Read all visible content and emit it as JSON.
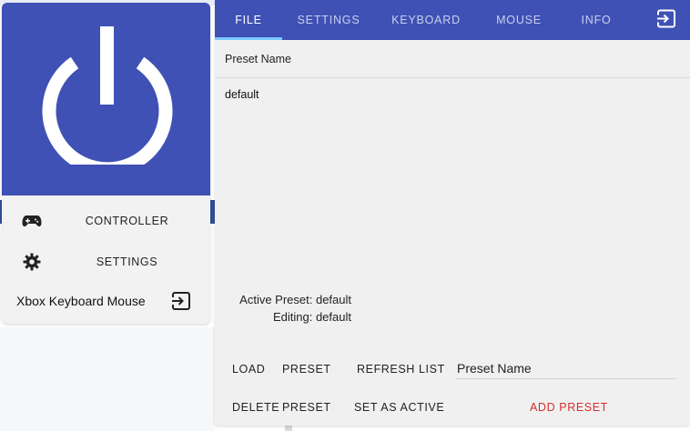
{
  "sidebar": {
    "items": [
      {
        "label": "CONTROLLER",
        "icon": "gamepad-icon"
      },
      {
        "label": "SETTINGS",
        "icon": "gear-icon"
      }
    ],
    "app_title": "Xbox Keyboard Mouse",
    "exit_icon": "exit-icon",
    "accent": "#3f51b5"
  },
  "tabs": [
    {
      "label": "FILE",
      "active": true
    },
    {
      "label": "SETTINGS",
      "active": false
    },
    {
      "label": "KEYBOARD",
      "active": false
    },
    {
      "label": "MOUSE",
      "active": false
    },
    {
      "label": "INFO",
      "active": false
    }
  ],
  "preset_list": {
    "header": "Preset Name",
    "items": [
      "default"
    ]
  },
  "status": {
    "active_preset": "Active Preset: default",
    "editing": "Editing: default"
  },
  "buttons": {
    "load": "LOAD",
    "preset": "PRESET",
    "refresh_list": "REFRESH LIST",
    "delete": "DELETE",
    "set_as_active": "SET AS ACTIVE",
    "add_preset": "ADD PRESET"
  },
  "input": {
    "placeholder": "Preset Name",
    "value": ""
  },
  "colors": {
    "primary": "#3f51b5",
    "tab_indicator": "#7ec8ff",
    "danger": "#d32f2f"
  }
}
